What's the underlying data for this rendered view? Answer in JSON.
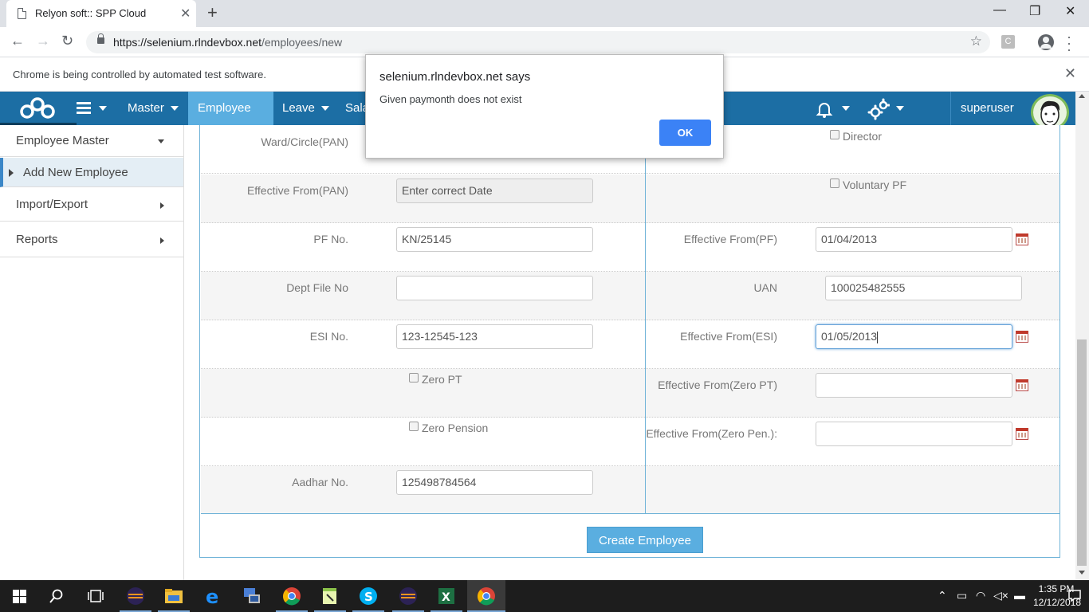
{
  "browser": {
    "tab_title": "Relyon soft:: SPP Cloud",
    "url_host": "https://selenium.rlndevbox.net",
    "url_path": "/employees/new",
    "ext_badge": "C",
    "infobar_text": "Chrome is being controlled by automated test software."
  },
  "navbar": {
    "items": [
      "Master",
      "Employee",
      "Leave",
      "Sala"
    ],
    "active": "Employee",
    "user": "superuser"
  },
  "sidebar": {
    "items": [
      {
        "label": "Employee Master"
      },
      {
        "label": "Add New Employee"
      },
      {
        "label": "Import/Export"
      },
      {
        "label": "Reports"
      }
    ]
  },
  "form": {
    "left": {
      "ward_label": "Ward/Circle(PAN)",
      "eff_pan_label": "Effective From(PAN)",
      "eff_pan_placeholder": "Enter correct Date",
      "pf_label": "PF No.",
      "pf_value": "KN/25145",
      "dept_label": "Dept File No",
      "dept_value": "",
      "esi_label": "ESI No.",
      "esi_value": "123-12545-123",
      "zero_pt_label": "Zero PT",
      "zero_pension_label": "Zero Pension",
      "aadhar_label": "Aadhar No.",
      "aadhar_value": "125498784564"
    },
    "right": {
      "director_label": "Director",
      "voluntary_pf_label": "Voluntary PF",
      "eff_pf_label": "Effective From(PF)",
      "eff_pf_value": "01/04/2013",
      "uan_label": "UAN",
      "uan_value": "100025482555",
      "eff_esi_label": "Effective From(ESI)",
      "eff_esi_value": "01/05/2013",
      "eff_zero_pt_label": "Effective From(Zero PT)",
      "eff_zero_pen_label": "Effective From(Zero Pen.):"
    },
    "create_button": "Create Employee"
  },
  "dialog": {
    "title": "selenium.rlndevbox.net says",
    "message": "Given paymonth does not exist",
    "ok": "OK"
  },
  "taskbar": {
    "time": "1:35 PM",
    "date": "12/12/2018"
  },
  "colors": {
    "navbar": "#1c6ea4",
    "accent": "#5aaee0",
    "dialog_button": "#3b82f6"
  }
}
